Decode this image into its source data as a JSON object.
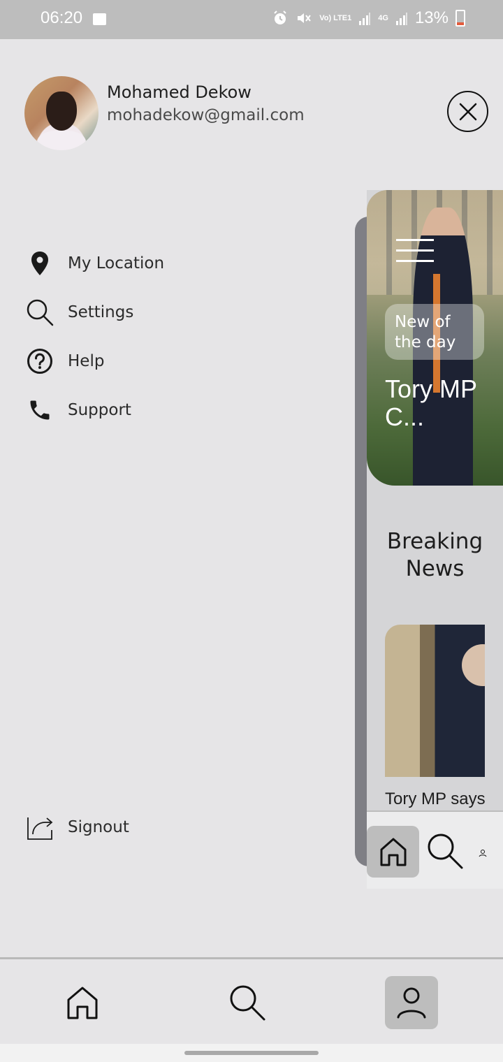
{
  "status_bar": {
    "time": "06:20",
    "network_label": "Vo) LTE1",
    "network_type": "4G",
    "battery_percent": "13%",
    "icons": [
      "image-icon",
      "alarm-icon",
      "mute-icon",
      "signal-icon",
      "battery-icon"
    ]
  },
  "profile": {
    "name": "Mohamed Dekow",
    "email": "mohadekow@gmail.com"
  },
  "menu": {
    "items": [
      {
        "label": "My Location",
        "icon": "location-pin-icon"
      },
      {
        "label": "Settings",
        "icon": "search-icon"
      },
      {
        "label": "Help",
        "icon": "help-circle-icon"
      },
      {
        "label": "Support",
        "icon": "phone-icon"
      }
    ],
    "signout_label": "Signout"
  },
  "preview": {
    "tag": "New of the day",
    "hero_title": "Tory MP C...",
    "section_title": "Breaking News",
    "card_caption": "Tory MP says"
  },
  "bottom_nav": {
    "items": [
      "home-icon",
      "search-icon",
      "profile-icon"
    ],
    "active": "profile-icon"
  },
  "colors": {
    "background": "#e6e5e7",
    "status_bar": "#bdbdbd",
    "active_tab": "#bdbdbd",
    "battery_low": "#e25b3d"
  }
}
